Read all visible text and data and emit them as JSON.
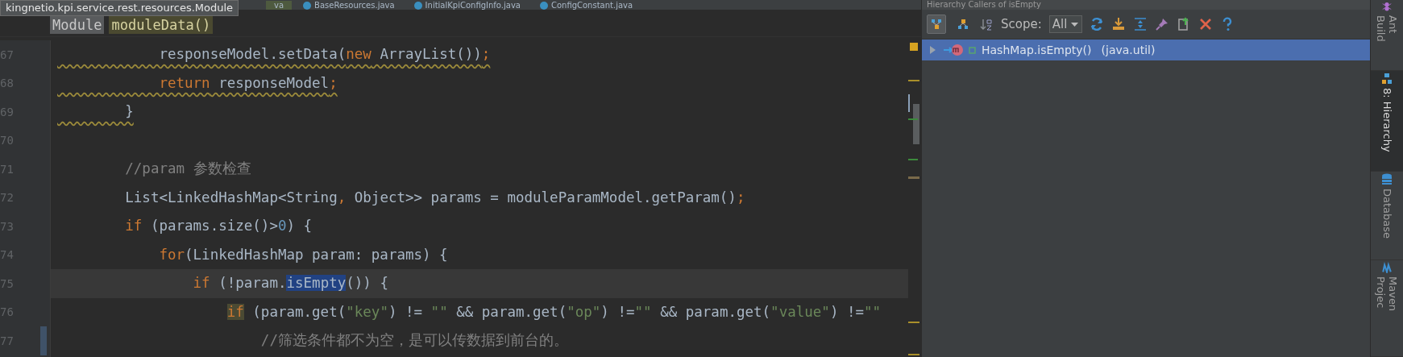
{
  "editor_tabs": [
    {
      "label": "va",
      "selected": true
    },
    {
      "label": "BaseResources.java",
      "selected": false
    },
    {
      "label": "InitialKpiConfigInfo.java",
      "selected": false
    },
    {
      "label": "ConfigConstant.java",
      "selected": false
    }
  ],
  "tooltip": "kingnetio.kpi.service.rest.resources.Module",
  "breadcrumbs": [
    {
      "label": "Module",
      "kind": "class"
    },
    {
      "label": "moduleData()",
      "kind": "method"
    }
  ],
  "lines": [
    {
      "number": "67",
      "warning": true,
      "current": false,
      "changed": false,
      "segments": [
        {
          "text": "            responseModel.setData(",
          "kind": "plain"
        },
        {
          "text": "new",
          "kind": "keyword"
        },
        {
          "text": " ArrayList())",
          "kind": "plain"
        },
        {
          "text": ";",
          "kind": "keyword"
        }
      ]
    },
    {
      "number": "68",
      "warning": true,
      "current": false,
      "changed": false,
      "segments": [
        {
          "text": "            return",
          "kind": "keyword"
        },
        {
          "text": " responseModel",
          "kind": "plain"
        },
        {
          "text": ";",
          "kind": "keyword"
        }
      ]
    },
    {
      "number": "69",
      "warning": true,
      "current": false,
      "changed": false,
      "segments": [
        {
          "text": "        }",
          "kind": "plain"
        }
      ]
    },
    {
      "number": "70",
      "warning": false,
      "current": false,
      "changed": false
    },
    {
      "number": "71",
      "warning": false,
      "current": false,
      "changed": false,
      "segments": [
        {
          "text": "        //param 参数检查",
          "kind": "comment"
        }
      ]
    },
    {
      "number": "72",
      "warning": false,
      "current": false,
      "changed": false,
      "segments": [
        {
          "text": "        List<LinkedHashMap<String",
          "kind": "plain"
        },
        {
          "text": ",",
          "kind": "keyword"
        },
        {
          "text": " Object>> params = moduleParamModel.getParam()",
          "kind": "plain"
        },
        {
          "text": ";",
          "kind": "keyword"
        }
      ]
    },
    {
      "number": "73",
      "warning": false,
      "current": false,
      "changed": false,
      "segments": [
        {
          "text": "        if",
          "kind": "keyword"
        },
        {
          "text": " (params.size()>",
          "kind": "plain"
        },
        {
          "text": "0",
          "kind": "number"
        },
        {
          "text": ") {",
          "kind": "plain"
        }
      ]
    },
    {
      "number": "74",
      "warning": false,
      "current": false,
      "changed": false,
      "segments": [
        {
          "text": "            for",
          "kind": "keyword"
        },
        {
          "text": "(LinkedHashMap param: params) {",
          "kind": "plain"
        }
      ]
    },
    {
      "number": "75",
      "warning": false,
      "current": true,
      "changed": false,
      "segments": [
        {
          "text": "                if",
          "kind": "keyword"
        },
        {
          "text": " (!param.",
          "kind": "plain"
        },
        {
          "text": "isEmpty",
          "kind": "selected"
        },
        {
          "text": "()) {",
          "kind": "plain"
        }
      ]
    },
    {
      "number": "76",
      "warning": false,
      "current": false,
      "changed": false,
      "segments": [
        {
          "text": "                    if",
          "kind": "match"
        },
        {
          "text": " (param.get(",
          "kind": "plain"
        },
        {
          "text": "\"key\"",
          "kind": "string"
        },
        {
          "text": ") != ",
          "kind": "plain"
        },
        {
          "text": "\"\"",
          "kind": "string"
        },
        {
          "text": " && param.get(",
          "kind": "plain"
        },
        {
          "text": "\"op\"",
          "kind": "string"
        },
        {
          "text": ") !=",
          "kind": "plain"
        },
        {
          "text": "\"\"",
          "kind": "string"
        },
        {
          "text": " && param.get(",
          "kind": "plain"
        },
        {
          "text": "\"value\"",
          "kind": "string"
        },
        {
          "text": ") !=",
          "kind": "plain"
        },
        {
          "text": "\"\"",
          "kind": "string"
        }
      ]
    },
    {
      "number": "77",
      "warning": false,
      "current": false,
      "changed": true,
      "segments": [
        {
          "text": "                        //筛选条件都不为空，是可以传数据到前台的。",
          "kind": "comment"
        }
      ]
    }
  ],
  "hierarchy": {
    "title": "Hierarchy Callers of isEmpty",
    "view_buttons": [
      {
        "selected": true
      },
      {
        "selected": false
      }
    ],
    "scope_label": "Scope:",
    "scope_value": "All",
    "nodes": [
      {
        "label": "HashMap.isEmpty()",
        "package": "(java.util)",
        "selected": true,
        "expanded": false
      }
    ]
  },
  "side_tabs": [
    {
      "label": "Ant Build",
      "selected": false
    },
    {
      "label": "8: Hierarchy",
      "selected": true
    },
    {
      "label": "Database",
      "selected": false
    },
    {
      "label": "Maven Projec",
      "selected": false
    }
  ]
}
